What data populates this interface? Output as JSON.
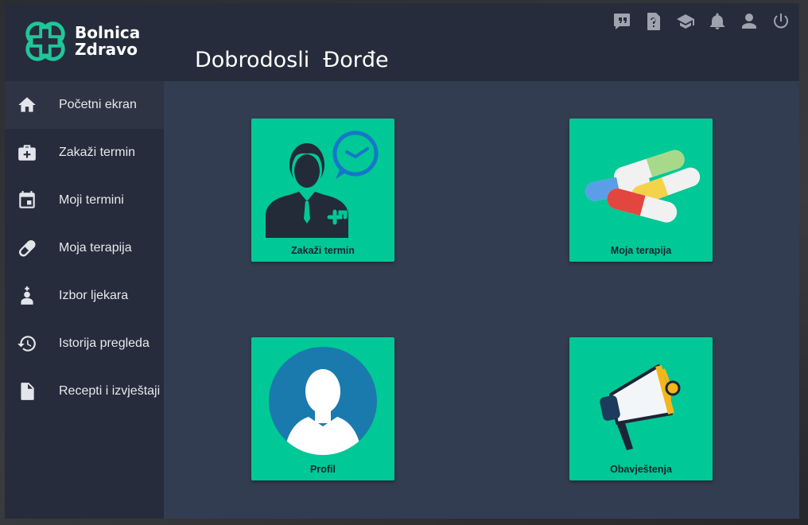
{
  "brand": {
    "line1": "Bolnica",
    "line2": "Zdravo",
    "color": "#1ec79a"
  },
  "header": {
    "welcome": "Dobrodosli  Đorđe",
    "icons": [
      "feedback-icon",
      "help-icon",
      "tutorial-icon",
      "notifications-icon",
      "profile-icon",
      "power-icon"
    ]
  },
  "sidebar": {
    "items": [
      {
        "label": "Početni ekran",
        "icon": "home-icon",
        "active": true
      },
      {
        "label": "Zakaži termin",
        "icon": "medical-bag-icon"
      },
      {
        "label": "Moji termini",
        "icon": "calendar-icon"
      },
      {
        "label": "Moja terapija",
        "icon": "pill-icon"
      },
      {
        "label": "Izbor ljekara",
        "icon": "doctor-icon"
      },
      {
        "label": "Istorija pregleda",
        "icon": "history-icon"
      },
      {
        "label": "Recepti i izvještaji",
        "icon": "document-icon"
      }
    ]
  },
  "tiles": [
    {
      "label": "Zakaži termin"
    },
    {
      "label": "Moja terapija"
    },
    {
      "label": "Profil"
    },
    {
      "label": "Obavještenja"
    }
  ],
  "colors": {
    "tile": "#00c896",
    "sidebar": "#262c3b",
    "main": "#333d51"
  }
}
